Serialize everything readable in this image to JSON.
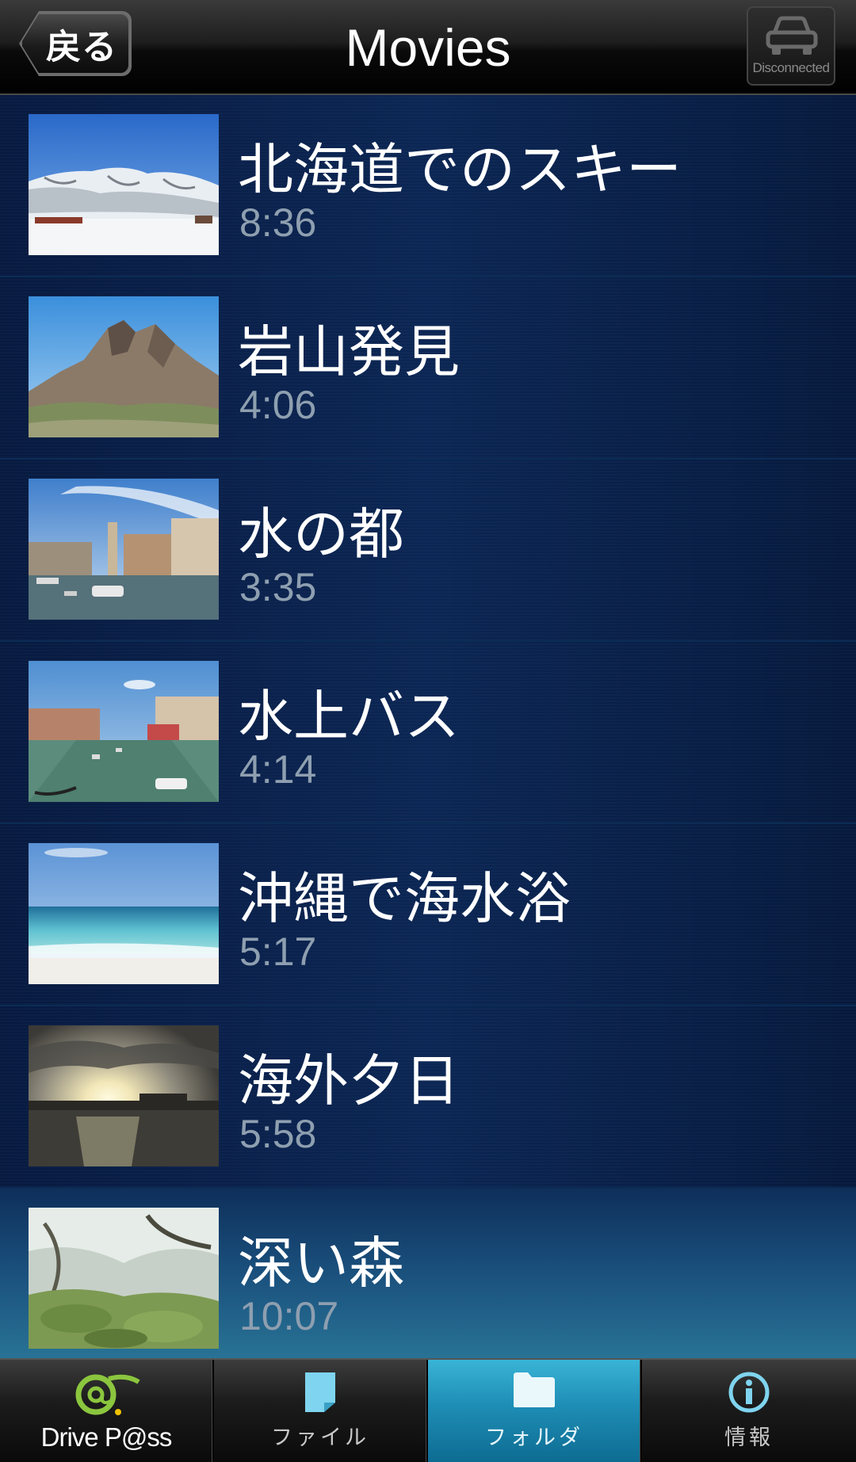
{
  "header": {
    "back_label": "戻る",
    "title": "Movies",
    "connection_status": "Disconnected",
    "connection_icon": "car-icon"
  },
  "movies": [
    {
      "title": "北海道でのスキー",
      "duration": "8:36",
      "thumbnail": "snowy-ski-slope"
    },
    {
      "title": "岩山発見",
      "duration": "4:06",
      "thumbnail": "rocky-mountain"
    },
    {
      "title": "水の都",
      "duration": "3:35",
      "thumbnail": "canal-city"
    },
    {
      "title": "水上バス",
      "duration": "4:14",
      "thumbnail": "canal-boats"
    },
    {
      "title": "沖縄で海水浴",
      "duration": "5:17",
      "thumbnail": "beach-sea"
    },
    {
      "title": "海外夕日",
      "duration": "5:58",
      "thumbnail": "sunset-coast"
    },
    {
      "title": "深い森",
      "duration": "10:07",
      "thumbnail": "mossy-forest"
    }
  ],
  "tabs": [
    {
      "label": "Drive P@ss",
      "icon": "drivepass-logo-icon",
      "active": false
    },
    {
      "label": "ファイル",
      "icon": "file-icon",
      "active": false
    },
    {
      "label": "フォルダ",
      "icon": "folder-icon",
      "active": true
    },
    {
      "label": "情報",
      "icon": "info-icon",
      "active": false
    }
  ],
  "colors": {
    "active_tab": "#1e8db5",
    "list_background": "#0b2654",
    "duration_text": "#8e9fb0"
  }
}
